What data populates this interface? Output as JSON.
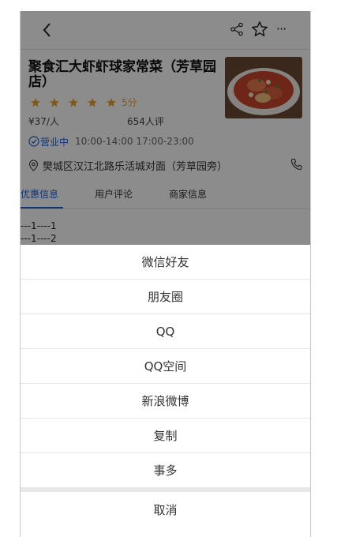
{
  "shop": {
    "name": "聚食汇大虾虾球家常菜（芳草园店）",
    "score": "5分",
    "price": "¥37/人",
    "reviews": "654人评",
    "status": "营业中",
    "hours": "10:00-14:00  17:00-23:00",
    "address": "樊城区汉江北路乐活城对面（芳草园旁）",
    "star_count": 5,
    "star_color": "#e8a43a"
  },
  "tabs": [
    {
      "label": "优惠信息",
      "active": true
    },
    {
      "label": "用户评论",
      "active": false
    },
    {
      "label": "商家信息",
      "active": false
    }
  ],
  "list": [
    "---1----1",
    "---1----2"
  ],
  "share_sheet": {
    "items": [
      "微信好友",
      "朋友圈",
      "QQ",
      "QQ空间",
      "新浪微博",
      "复制",
      "事多"
    ],
    "cancel": "取消"
  },
  "colors": {
    "accent": "#1e5fd6",
    "overlay": "rgba(0,0,0,0.45)"
  },
  "icons": [
    "back-arrow-icon",
    "share-icon",
    "star-outline-icon",
    "more-icon",
    "clock-icon",
    "location-pin-icon",
    "phone-icon"
  ]
}
